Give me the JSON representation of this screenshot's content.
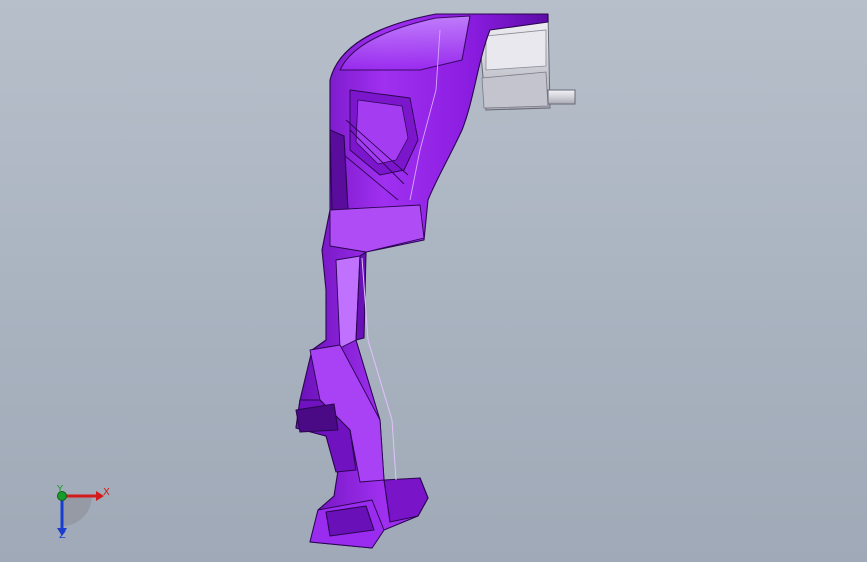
{
  "viewport": {
    "background_top": "#b7bfca",
    "background_bottom": "#9fa9b7"
  },
  "model": {
    "icon": "cad-part-shaded",
    "primary_color": "#9a22e8",
    "highlight_color": "#c070ff",
    "shadow_color": "#5a0f9a",
    "metal_color": "#d9d9e0"
  },
  "triad": {
    "icon": "coordinate-triad-icon",
    "x_label": "X",
    "y_label": "Y",
    "z_label": "Z",
    "x_color": "#d41a1a",
    "y_color": "#1a9c2a",
    "z_color": "#1a3ccf"
  }
}
